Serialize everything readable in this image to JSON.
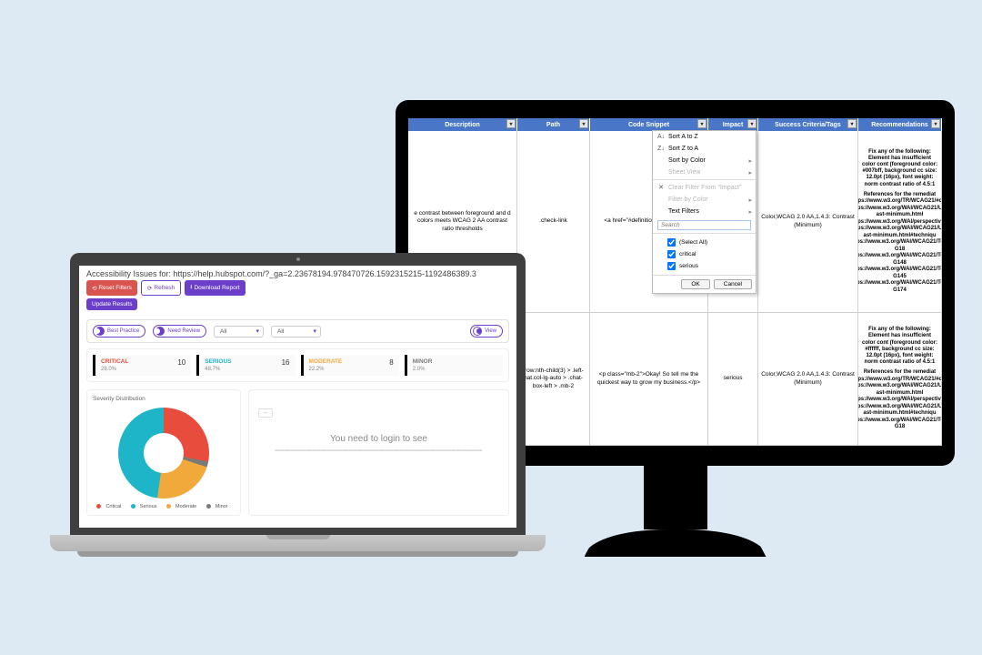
{
  "spreadsheet": {
    "headers": {
      "description": "Description",
      "path": "Path",
      "code": "Code Snippet",
      "impact": "Impact",
      "criteria": "Success Criteria/Tags",
      "recommendations": "Recommendations"
    },
    "rows": [
      {
        "description": "e contrast between foreground and d colors meets WCAG 2 AA contrast ratio thresholds",
        "path": ".check-link",
        "code": "<a href=\"#definition text-primary\">",
        "impact": "",
        "criteria": "Color,WCAG 2.0 AA,1.4.3: Contrast (Minimum)",
        "rec_main": "Fix any of the following:\nElement has insufficient color cont\n(foreground color: #007bff, background cc\nsize: 12.0pt (16px), font weight: norm\ncontrast ratio of 4.5:1",
        "rec_refs": "References for the remediat\nhttps://www.w3.org/TR/WCAG21/#con\nhttps://www.w3.org/WAI/WCAG21/Und\nast-minimum.html\nhttps://www.w3.org/WAI/perspective-v\nhttps://www.w3.org/WAI/WCAG21/Und\nast-minimum.html#techniqu\nhttps://www.w3.org/WAI/WCAG21/Tech\nG18\nhttps://www.w3.org/WAI/WCAG21/Tech\nG148\nhttps://www.w3.org/WAI/WCAG21/Tech\nG145\nhttps://www.w3.org/WAI/WCAG21/Tech\nG174"
      },
      {
        "description": "",
        "path": ".row:nth-child(3) > .left-hat.col-lg-auto > .chat-box-left > .mb-2",
        "code": "<p class=\"mb-2\">Okay! So tell me the quickest way to grow my business.</p>",
        "impact": "serious",
        "criteria": "Color,WCAG 2.0 AA,1.4.3: Contrast (Minimum)",
        "rec_main": "Fix any of the following:\nElement has insufficient color cont\n(foreground color: #ffffff, background cc\nsize: 12.0pt (16px), font weight: norm\ncontrast ratio of 4.5:1",
        "rec_refs": "References for the remediat\nhttps://www.w3.org/TR/WCAG21/#con\nhttps://www.w3.org/WAI/WCAG21/Und\nast-minimum.html\nhttps://www.w3.org/WAI/perspective-v\nhttps://www.w3.org/WAI/WCAG21/Und\nast-minimum.html#techniqu\nhttps://www.w3.org/WAI/WCAG21/Tech\nG18"
      }
    ],
    "filter_menu": {
      "sort_az": "Sort A to Z",
      "sort_za": "Sort Z to A",
      "sort_color": "Sort by Color",
      "sheet_view": "Sheet View",
      "clear_filter": "Clear Filter From \"Impact\"",
      "filter_color": "Filter by Color",
      "text_filters": "Text Filters",
      "search_placeholder": "Search",
      "select_all": "(Select All)",
      "opt_critical": "critical",
      "opt_serious": "serious",
      "ok": "OK",
      "cancel": "Cancel"
    }
  },
  "app": {
    "title": "Accessibility Issues for: https://help.hubspot.com/?_ga=2.23678194.978470726.1592315215-1192486389.3",
    "btn_reset": "Reset Filters",
    "btn_refresh": "Refresh",
    "btn_download": "Download Report",
    "btn_update": "Update Results",
    "pill_best": "Best Practice",
    "pill_review": "Need Review",
    "sel_all1": "All",
    "sel_all2": "All",
    "view_label": "View",
    "cards": {
      "critical": {
        "label": "CRITICAL",
        "count": "10",
        "pct": "28.0%"
      },
      "serious": {
        "label": "SERIOUS",
        "count": "16",
        "pct": "48.7%"
      },
      "moderate": {
        "label": "MODERATE",
        "count": "8",
        "pct": "22.2%"
      },
      "minor": {
        "label": "MINOR",
        "count": "",
        "pct": "2.0%"
      }
    },
    "chart_title": "Severity Distribution",
    "legend": {
      "critical": "Critical",
      "serious": "Serious",
      "moderate": "Moderate",
      "minor": "Minor"
    },
    "login_badge": "—",
    "login_msg": "You need to login to see"
  },
  "chart_data": {
    "type": "pie",
    "title": "Severity Distribution",
    "categories": [
      "Critical",
      "Serious",
      "Moderate",
      "Minor"
    ],
    "values": [
      28.0,
      48.7,
      22.2,
      2.0
    ],
    "colors": [
      "#e74c3c",
      "#1fb5c9",
      "#f2a93b",
      "#7a7a7a"
    ]
  }
}
